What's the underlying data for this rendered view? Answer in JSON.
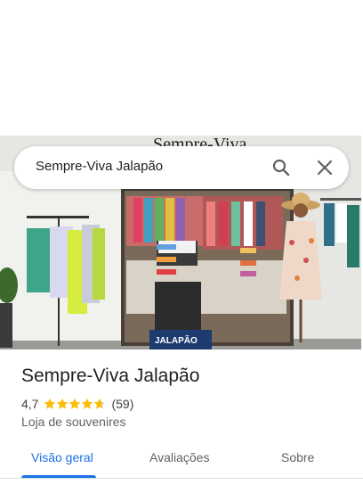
{
  "search": {
    "query": "Sempre-Viva Jalapão"
  },
  "photo": {
    "sign_text": "Sempre-Viva",
    "plate_text": "JALAPÃO"
  },
  "place": {
    "name": "Sempre-Viva Jalapão",
    "rating": "4,7",
    "rating_fraction": 0.94,
    "review_count": "(59)",
    "category": "Loja de souvenires"
  },
  "tabs": [
    {
      "label": "Visão geral",
      "active": true
    },
    {
      "label": "Avaliações",
      "active": false
    },
    {
      "label": "Sobre",
      "active": false
    }
  ],
  "colors": {
    "accent": "#1a73e8",
    "star": "#fbbc04",
    "text": "#202124",
    "muted": "#5f6368"
  },
  "icons": {
    "search": "search-icon",
    "close": "close-icon",
    "star": "star-icon"
  }
}
